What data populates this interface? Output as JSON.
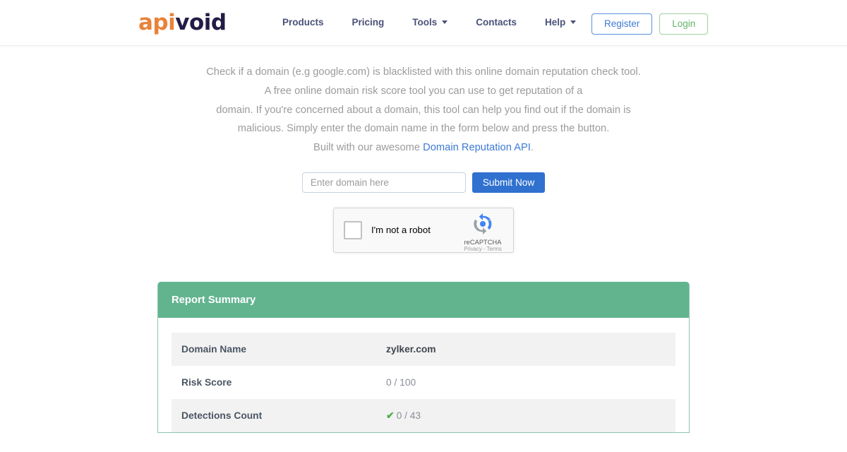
{
  "header": {
    "logo": {
      "part1": "api",
      "part2": "void",
      "color1": "#e8833a",
      "color2": "#221c46"
    },
    "nav": [
      {
        "label": "Products",
        "caret": false
      },
      {
        "label": "Pricing",
        "caret": false
      },
      {
        "label": "Tools",
        "caret": true
      },
      {
        "label": "Contacts",
        "caret": false
      },
      {
        "label": "Help",
        "caret": true
      }
    ],
    "register_label": "Register",
    "login_label": "Login",
    "register_color": "#3d7ad6",
    "login_color": "#62b368"
  },
  "intro": {
    "line1": "Check if a domain (e.g google.com) is blacklisted with this online domain reputation check tool.",
    "line2": "A free online domain risk score tool you can use to get reputation of a",
    "line3": "domain. If you're concerned about a domain, this tool can help you find out if the domain is",
    "line4": "malicious. Simply enter the domain name in the form below and press the button.",
    "line5_prefix": "Built with our awesome ",
    "line5_link": "Domain Reputation API",
    "line5_suffix": ".",
    "link_color": "#3d7ad6"
  },
  "form": {
    "placeholder": "Enter domain here",
    "value": "",
    "submit_label": "Submit Now",
    "submit_color": "#3071d0"
  },
  "recaptcha": {
    "checkbox_checked": false,
    "label": "I'm not a robot",
    "brand": "reCAPTCHA",
    "terms": "Privacy - Terms",
    "icon": "recaptcha-logo-icon"
  },
  "report": {
    "title": "Report Summary",
    "header_color": "#62b48f",
    "rows": [
      {
        "key": "Domain Name",
        "value": "zylker.com",
        "bold": true,
        "tick": false
      },
      {
        "key": "Risk Score",
        "value": "0 / 100",
        "bold": false,
        "tick": false
      },
      {
        "key": "Detections Count",
        "value": "0 / 43",
        "bold": false,
        "tick": true,
        "tick_glyph": "✔",
        "tick_color": "#4caf50"
      }
    ]
  }
}
